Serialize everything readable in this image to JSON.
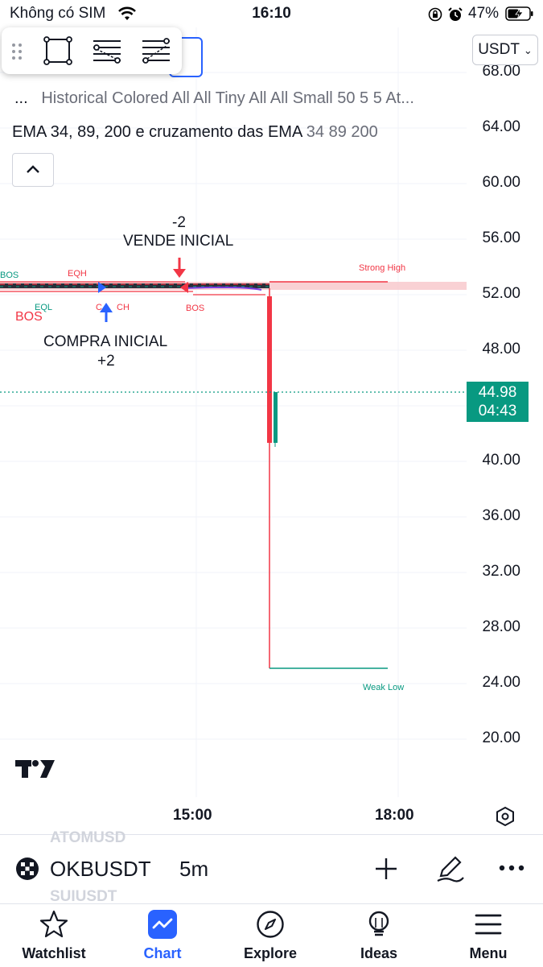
{
  "status_bar": {
    "carrier": "Không có SIM",
    "time": "16:10",
    "battery": "47%"
  },
  "toolbar": {
    "tools": [
      "rectangle-tool-icon",
      "fib-retracement-icon",
      "trend-based-fib-icon"
    ]
  },
  "currency_button": {
    "label": "USDT"
  },
  "legend": {
    "indicator1": "Historical Colored All All Tiny All All Small 50 5 5 At...",
    "indicator1_prefix": "...",
    "indicator2_name": "EMA 34, 89, 200 e cruzamento das EMA",
    "indicator2_params": "34 89 200"
  },
  "price_axis": {
    "labels": [
      "68.00",
      "64.00",
      "60.00",
      "56.00",
      "52.00",
      "48.00",
      "40.00",
      "36.00",
      "32.00",
      "28.00",
      "24.00",
      "20.00"
    ]
  },
  "current_price": {
    "value": "44.98",
    "countdown": "04:43"
  },
  "time_axis": {
    "labels": [
      "15:00",
      "18:00"
    ]
  },
  "annotations": {
    "sell_count": "-2",
    "sell_text": "VENDE INICIAL",
    "buy_text": "COMPRA INICIAL",
    "buy_count": "+2",
    "strong_high": "Strong High",
    "weak_low": "Weak Low",
    "eqh": "EQH",
    "eql": "EQL",
    "bos_left": "BOS",
    "bos_left_red": "BOS",
    "bos_right": "BOS",
    "choch": "CH",
    "choch_prefix": "C"
  },
  "symbol_bar": {
    "symbol": "OKBUSDT",
    "timeframe": "5m",
    "ghost_top": "ATOMUSD",
    "ghost_bottom": "SUIUSDT"
  },
  "tabs": [
    {
      "label": "Watchlist",
      "icon": "star-icon",
      "active": false
    },
    {
      "label": "Chart",
      "icon": "chart-icon",
      "active": true
    },
    {
      "label": "Explore",
      "icon": "compass-icon",
      "active": false
    },
    {
      "label": "Ideas",
      "icon": "lightbulb-icon",
      "active": false
    },
    {
      "label": "Menu",
      "icon": "hamburger-icon",
      "active": false
    }
  ],
  "colors": {
    "up": "#089981",
    "down": "#f23645",
    "accent": "#2962ff",
    "strong_high_zone": "#f7c6c9"
  }
}
